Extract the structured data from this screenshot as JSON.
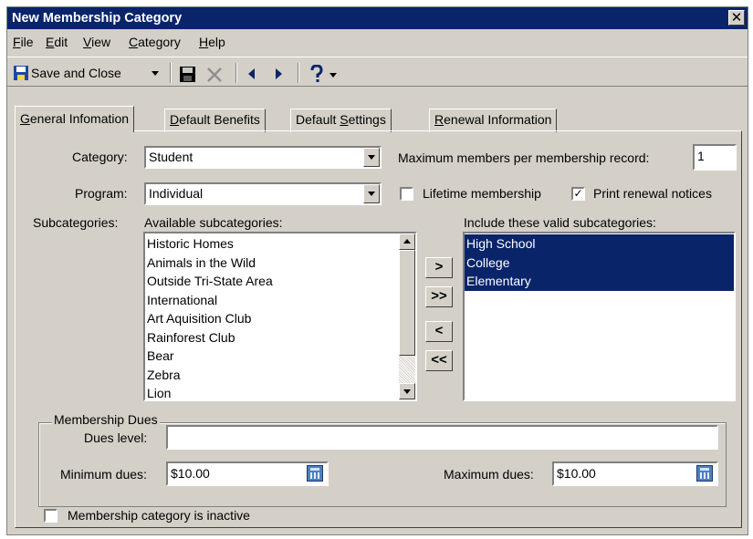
{
  "window": {
    "title": "New Membership Category",
    "close_glyph": "✕"
  },
  "menu": [
    {
      "key": "F",
      "rest": "ile"
    },
    {
      "key": "E",
      "rest": "dit"
    },
    {
      "key": "V",
      "rest": "iew"
    },
    {
      "key": "C",
      "rest": "ategory"
    },
    {
      "key": "H",
      "rest": "elp"
    }
  ],
  "toolbar": {
    "save_and_close": "Save and Close",
    "icons": [
      "save-close-icon",
      "dropdown-arrow-icon",
      "save-icon",
      "delete-icon",
      "previous-icon",
      "next-icon",
      "help-icon",
      "dropdown-arrow-icon"
    ]
  },
  "tabs": [
    {
      "key": "G",
      "rest": "eneral Infomation"
    },
    {
      "key": "D",
      "rest": "efault Benefits"
    },
    {
      "pre": "Default ",
      "key": "S",
      "rest": "ettings"
    },
    {
      "key": "R",
      "rest": "enewal Information"
    }
  ],
  "form": {
    "category_label": "Category:",
    "category_value": "Student",
    "program_label": "Program:",
    "program_value": "Individual",
    "max_members_label": "Maximum members per membership record:",
    "max_members_value": "1",
    "lifetime_label": "Lifetime membership",
    "lifetime_checked": false,
    "print_renewal_label": "Print renewal notices",
    "print_renewal_checked": true,
    "subcategories_label": "Subcategories:",
    "available_label": "Available subcategories:",
    "available": [
      "Historic Homes",
      "Animals in the Wild",
      "Outside Tri-State Area",
      "International",
      "Art Aquisition Club",
      "Rainforest Club",
      "Bear",
      "Zebra",
      "Lion"
    ],
    "included_label": "Include these valid subcategories:",
    "included": [
      "High School",
      "College",
      "Elementary"
    ],
    "move_buttons": [
      ">",
      ">>",
      "<",
      "<<"
    ]
  },
  "dues": {
    "group_label": "Membership Dues",
    "level_label": "Dues level:",
    "level_value": "",
    "min_label": "Minimum dues:",
    "min_value": "$10.00",
    "max_label": "Maximum dues:",
    "max_value": "$10.00"
  },
  "inactive_label": "Membership category is inactive",
  "colors": {
    "title_bar": "#0a246a",
    "selection": "#0a246a",
    "face": "#d4d0c8"
  }
}
